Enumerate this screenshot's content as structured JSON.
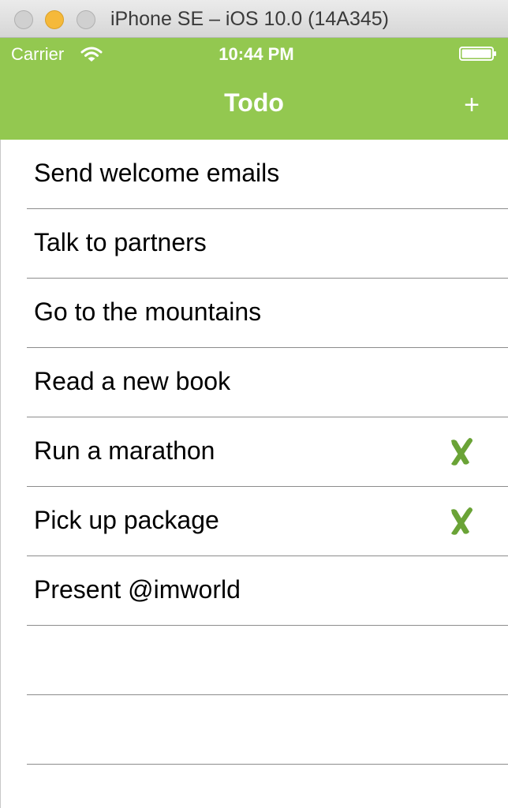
{
  "window": {
    "title": "iPhone SE – iOS 10.0 (14A345)"
  },
  "status_bar": {
    "carrier": "Carrier",
    "time": "10:44 PM"
  },
  "nav": {
    "title": "Todo",
    "add_label": "+"
  },
  "colors": {
    "header": "#93c850",
    "check": "#6aa336"
  },
  "todos": [
    {
      "label": "Send welcome emails",
      "done": false
    },
    {
      "label": "Talk to partners",
      "done": false
    },
    {
      "label": "Go to the mountains",
      "done": false
    },
    {
      "label": "Read a new book",
      "done": false
    },
    {
      "label": "Run a marathon",
      "done": true
    },
    {
      "label": "Pick up package",
      "done": true
    },
    {
      "label": "Present @imworld",
      "done": false
    },
    {
      "label": "",
      "done": false
    },
    {
      "label": "",
      "done": false
    }
  ]
}
